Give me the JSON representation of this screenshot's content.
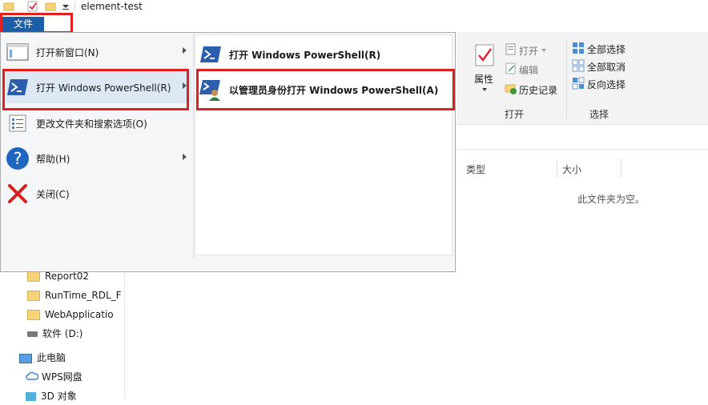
{
  "window": {
    "title": "element-test"
  },
  "file_menu": {
    "tab_label": "文件",
    "items": [
      {
        "label": "打开新窗口(N)",
        "icon": "new-window-icon",
        "has_submenu": true
      },
      {
        "label": "打开 Windows PowerShell(R)",
        "icon": "powershell-icon",
        "has_submenu": true,
        "selected": true
      },
      {
        "label": "更改文件夹和搜索选项(O)",
        "icon": "options-icon",
        "has_submenu": false
      },
      {
        "label": "帮助(H)",
        "icon": "help-icon",
        "has_submenu": true
      },
      {
        "label": "关闭(C)",
        "icon": "close-icon",
        "has_submenu": false
      }
    ],
    "submenu": [
      {
        "label": "打开 Windows PowerShell(R)",
        "icon": "powershell-icon"
      },
      {
        "label": "以管理员身份打开 Windows PowerShell(A)",
        "icon": "powershell-admin-icon"
      }
    ]
  },
  "ribbon": {
    "open_group": {
      "properties_label": "属性",
      "open_label": "打开",
      "edit_label": "编辑",
      "history_label": "历史记录",
      "group_label": "打开"
    },
    "select_group": {
      "select_all_label": "全部选择",
      "select_none_label": "全部取消",
      "invert_label": "反向选择",
      "group_label": "选择"
    }
  },
  "file_list": {
    "columns": [
      "类型",
      "大小"
    ],
    "empty_message": "此文件夹为空。"
  },
  "nav_pane": {
    "items": [
      {
        "label": "Report02",
        "icon": "folder-icon"
      },
      {
        "label": "RunTime_RDL_F",
        "icon": "folder-icon"
      },
      {
        "label": "WebApplicatio",
        "icon": "folder-icon"
      },
      {
        "label": "软件 (D:)",
        "icon": "drive-icon"
      },
      {
        "label": "此电脑",
        "icon": "computer-icon"
      },
      {
        "label": "WPS网盘",
        "icon": "cloud-icon"
      },
      {
        "label": "3D 对象",
        "icon": "3d-objects-icon"
      }
    ]
  },
  "colors": {
    "accent": "#1a5fa8",
    "highlight_box": "#e02020",
    "powershell_blue": "#2b5fae"
  }
}
